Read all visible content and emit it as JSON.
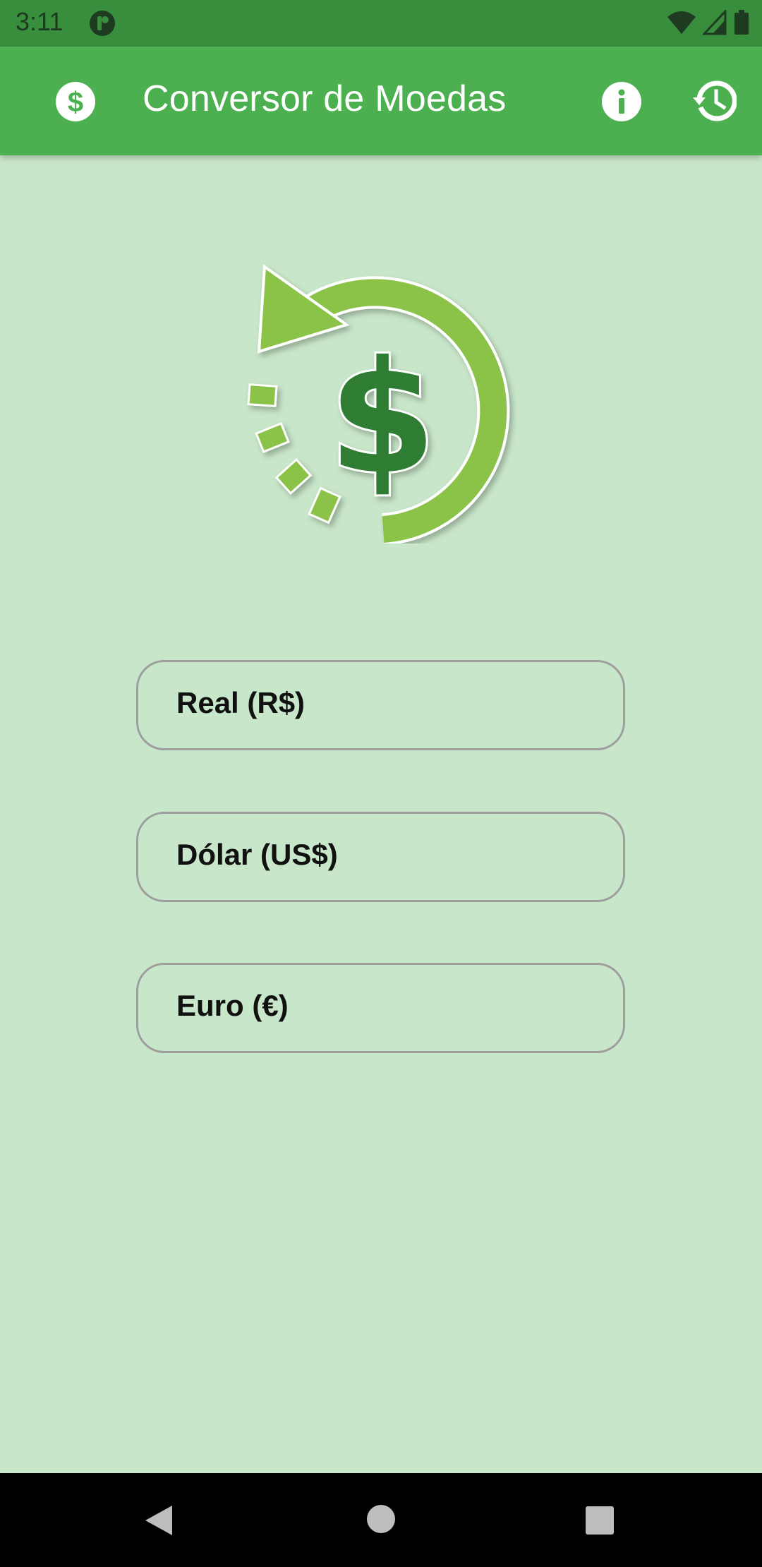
{
  "status_bar": {
    "time": "3:11",
    "icons": [
      "app-notification-icon",
      "wifi-icon",
      "signal-icon",
      "battery-icon"
    ]
  },
  "app_bar": {
    "title": "Conversor de Moedas",
    "icons": {
      "logo": "dollar-circle-icon",
      "info": "info-icon",
      "history": "history-icon"
    }
  },
  "hero": {
    "icon": "currency-exchange-icon"
  },
  "fields": [
    {
      "label": "Real (R$)"
    },
    {
      "label": "Dólar (US$)"
    },
    {
      "label": "Euro (€)"
    }
  ],
  "nav_bar": {
    "icons": [
      "back-icon",
      "home-icon",
      "recents-icon"
    ]
  },
  "colors": {
    "status_bar": "#388e3c",
    "app_bar": "#4caf50",
    "background": "#c8e6c9",
    "logo_arrow": "#8bc34a",
    "logo_dollar": "#2e7d32",
    "field_border": "#9e9e9e"
  }
}
